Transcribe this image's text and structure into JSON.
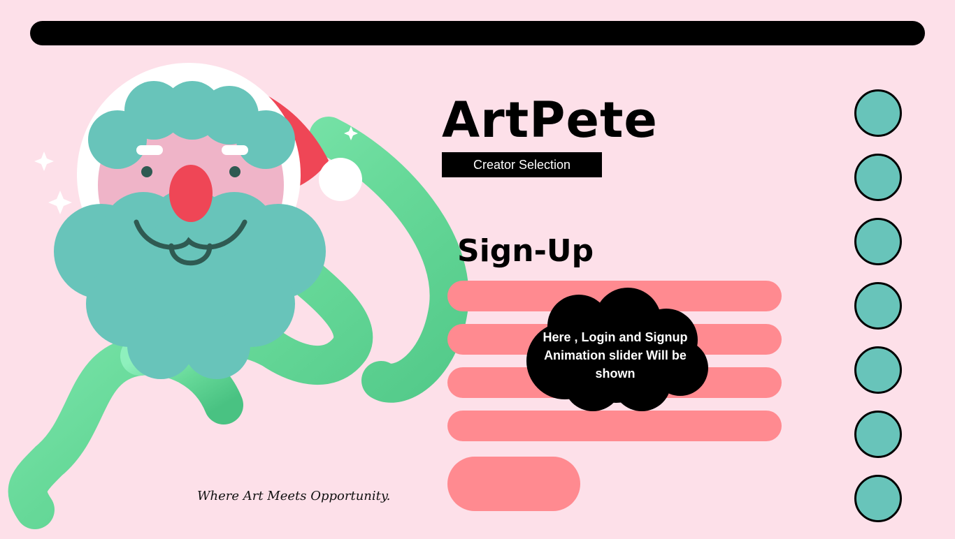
{
  "brand": {
    "title": "ArtPete",
    "badge": "Creator Selection"
  },
  "signup": {
    "title": "Sign-Up",
    "fields": [
      {
        "value": "",
        "placeholder": ""
      },
      {
        "value": "",
        "placeholder": ""
      },
      {
        "value": "",
        "placeholder": ""
      },
      {
        "value": "",
        "placeholder": ""
      }
    ],
    "submit_label": ""
  },
  "notice": {
    "text": "Here , Login and Signup Animation slider Will be shown"
  },
  "tagline": "Where Art Meets Opportunity.",
  "slider_dots": {
    "count": 7,
    "color": "#68c4ba"
  },
  "colors": {
    "background": "#fde0e9",
    "field": "#ff8a90",
    "teal": "#68c4ba",
    "tube": "#6fe0a5",
    "hat": "#ef4656"
  },
  "icons": [
    "santa-illustration-icon",
    "sparkle-icon",
    "cloud-icon"
  ]
}
